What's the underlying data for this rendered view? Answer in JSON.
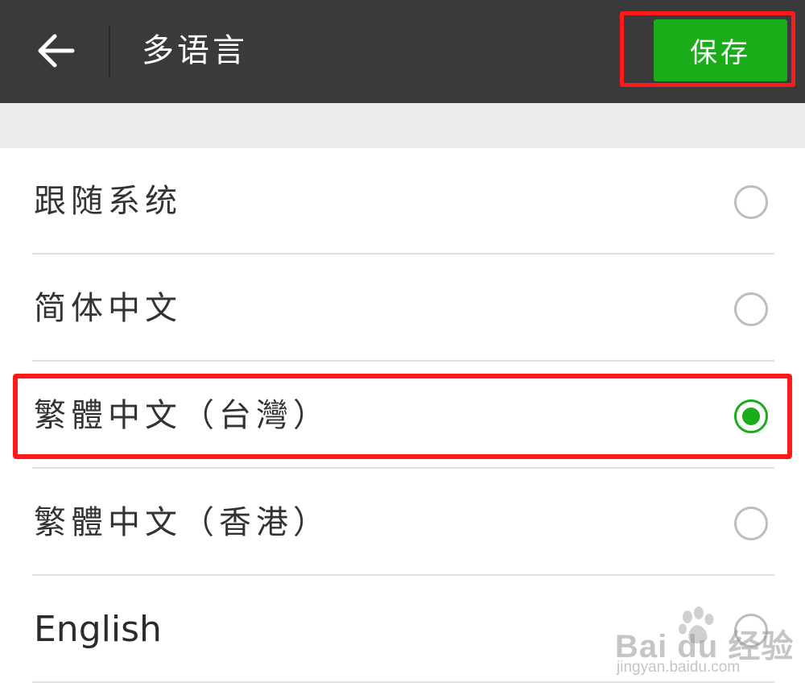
{
  "header": {
    "title": "多语言",
    "save_label": "保存",
    "back_icon": "arrow-left-icon"
  },
  "languages": [
    {
      "label": "跟随系统",
      "selected": false
    },
    {
      "label": "简体中文",
      "selected": false
    },
    {
      "label": "繁體中文（台灣）",
      "selected": true
    },
    {
      "label": "繁體中文（香港）",
      "selected": false
    },
    {
      "label": "English",
      "selected": false
    }
  ],
  "watermark": {
    "main": "Bai du 经验",
    "sub": "jingyan.baidu.com"
  },
  "colors": {
    "topbar": "#3a3a3c",
    "accent_green": "#1aad19",
    "highlight_red": "#ff1a1a"
  }
}
